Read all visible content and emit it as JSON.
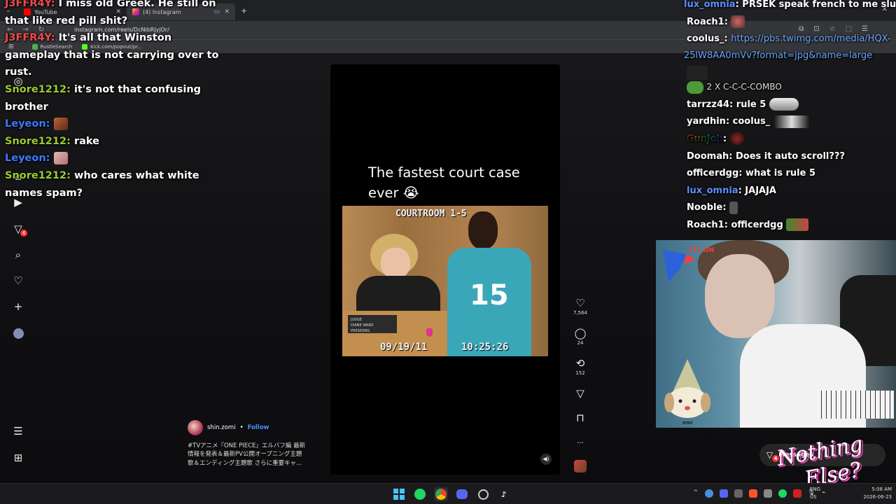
{
  "browser": {
    "tabs": [
      {
        "title": "YouTube",
        "active": false
      },
      {
        "title": "(4) Instagram",
        "active": true
      }
    ],
    "new_tab": "+",
    "url": "instagram.com/reels/DcNibRjyjOr/",
    "bookmarks": [
      "RustleSearch",
      "kick.com/popout/pr..."
    ]
  },
  "left_chat": [
    {
      "user": "J3FFR4Y",
      "user_color": "#f04a4a",
      "text": "I miss old Greek. He still on that like red pill shit?",
      "emote": false
    },
    {
      "user": "J3FFR4Y",
      "user_color": "#f04a4a",
      "text": "It's all that Winston gameplay that is not carrying over to rust.",
      "emote": false
    },
    {
      "user": "Snore1212",
      "user_color": "#9acd32",
      "text": "it's not that confusing brother",
      "emote": false
    },
    {
      "user": "Leyeon",
      "user_color": "#3d7bff",
      "text": "",
      "emote": true
    },
    {
      "user": "Snore1212",
      "user_color": "#9acd32",
      "text": "rake",
      "emote": false
    },
    {
      "user": "Leyeon",
      "user_color": "#3d7bff",
      "text": "",
      "emote": true
    },
    {
      "user": "Snore1212",
      "user_color": "#9acd32",
      "text": "who cares what white names spam?",
      "emote": false
    }
  ],
  "ig_nav": {
    "items": [
      "instagram-icon",
      "home-icon",
      "reels-icon",
      "direct-icon",
      "search-icon",
      "heart-icon",
      "create-icon",
      "profile-avatar",
      "menu-icon",
      "apps-icon"
    ],
    "direct_badge": "4"
  },
  "video": {
    "caption": "The fastest court case ever 😭",
    "clip_label_top": "COURTROOM 1-5",
    "clip_date": "09/19/11",
    "clip_time": "10:25:26",
    "nameplate_lines": [
      "JUDGE",
      "DIANE WARD",
      "PRESIDING"
    ],
    "jersey_number": "15"
  },
  "actions": {
    "likes": "7,564",
    "comments": "24",
    "reposts": "152",
    "more": "..."
  },
  "author": {
    "name": "shin.zomi",
    "separator": "•",
    "follow_label": "Follow",
    "description_lines": [
      "#TVアニメ『ONE PIECE』エルバフ編 最新",
      "情報を発表＆最新PV公開オープニング主題",
      "歌＆エンディング主題歌 さらに重要キャ..."
    ]
  },
  "right_chat": [
    {
      "user": "lux_omnia",
      "user_color": "#5d8fff",
      "text": "PRSEK speak french to me slut\\"
    },
    {
      "user": "Roach1",
      "user_color": "#ffffff",
      "text": "",
      "emote": true
    },
    {
      "user": "coolus_",
      "user_color": "#ffffff",
      "text": "https://pbs.twimg.com/media/HQX-25lW8AA0mVv?format=jpg&name=large",
      "link": true
    },
    {
      "user": "",
      "user_color": "#ffffff",
      "text": "2 X C-C-C-COMBO",
      "combo": true
    },
    {
      "user": "tarrzz44",
      "user_color": "#ffffff",
      "text": "rule 5"
    },
    {
      "user": "yardhin",
      "user_color": "#ffffff",
      "text": "coolus_"
    },
    {
      "user": "Gunjob",
      "user_color": "rainbow",
      "text": "",
      "emote": true
    },
    {
      "user": "Doomah",
      "user_color": "#ffffff",
      "text": "Does it auto scroll???"
    },
    {
      "user": "officerdgg",
      "user_color": "#ffffff",
      "text": "what is rule 5"
    },
    {
      "user": "lux_omnia",
      "user_color": "#5d8fff",
      "text": "JAJAJA"
    },
    {
      "user": "Nooble",
      "user_color": "#ffffff",
      "text": "",
      "emote": true
    },
    {
      "user": "Roach1",
      "user_color": "#ffffff",
      "text": "officerdgg"
    }
  ],
  "webcam": {
    "tts_label": "TTS ON",
    "gnome_label": "emi"
  },
  "messages": {
    "label": "Messages",
    "badge": "4"
  },
  "logo": {
    "line1": "Nothing",
    "line2": "Else?"
  },
  "taskbar": {
    "apps": [
      "windows-start-icon",
      "spotify-icon",
      "chrome-icon",
      "discord-icon",
      "steam-icon",
      "tiktok-icon"
    ],
    "lang": [
      "ENG",
      "US"
    ],
    "time": "5:08 AM",
    "date": "2026-06-23"
  },
  "colors": {
    "ig_badge": "#ff3040",
    "follow_link": "#4a90ff",
    "chat_green": "#9acd32",
    "chat_red": "#f04a4a",
    "chat_blue": "#3d7bff"
  }
}
